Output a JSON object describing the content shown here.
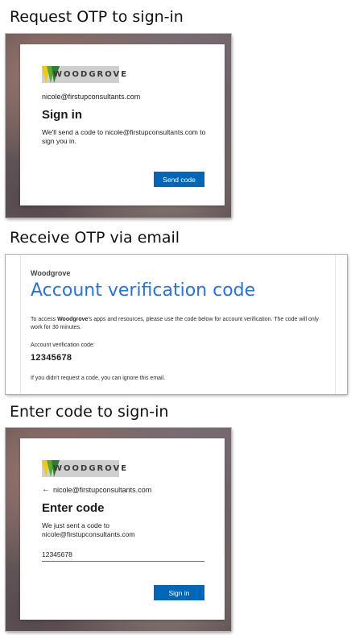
{
  "sections": {
    "request_title": "Request OTP to sign-in",
    "receive_title": "Receive OTP via email",
    "enter_title": "Enter code to sign-in"
  },
  "signin_card": {
    "logo_text": "WOODGROVE",
    "email": "nicole@firstupconsultants.com",
    "heading": "Sign in",
    "message": "We'll send a code to nicole@firstupconsultants.com to sign you in.",
    "button_label": "Send code"
  },
  "email_message": {
    "brand": "Woodgrove",
    "title": "Account verification code",
    "body_prefix": "To access ",
    "body_brand": "Woodgrove",
    "body_suffix": "'s apps and resources, please use the code below for account verification. The code will only work for 30 minutes.",
    "code_label": "Account verification code:",
    "code": "12345678",
    "ignore_note": "If you didn't request a code, you can ignore this email."
  },
  "entercode_card": {
    "logo_text": "WOODGROVE",
    "back_arrow": "←",
    "email": "nicole@firstupconsultants.com",
    "heading": "Enter code",
    "message": "We just sent a code to nicole@firstupconsultants.com",
    "code_value": "12345678",
    "button_label": "Sign in"
  },
  "colors": {
    "primary_button": "#0067b8",
    "email_title": "#2672ec",
    "logo_background": "#cfcfcf"
  }
}
